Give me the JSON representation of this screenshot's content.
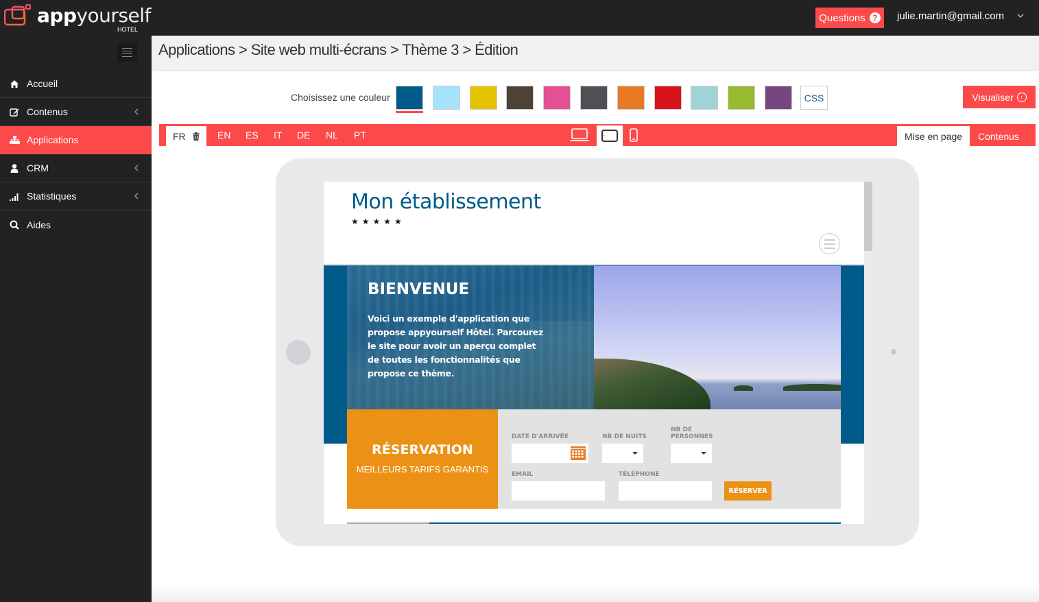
{
  "app": {
    "logo_text_bold": "app",
    "logo_text_light": "yourself",
    "logo_sub": "HOTEL"
  },
  "header": {
    "questions_label": "Questions",
    "questions_icon": "question-circle-icon",
    "user_email": "julie.martin@gmail.com"
  },
  "sidebar": {
    "items": [
      {
        "label": "Accueil",
        "icon": "home-icon",
        "has_submenu": false,
        "active": false
      },
      {
        "label": "Contenus",
        "icon": "edit-icon",
        "has_submenu": true,
        "active": false
      },
      {
        "label": "Applications",
        "icon": "sitemap-icon",
        "has_submenu": false,
        "active": true
      },
      {
        "label": "CRM",
        "icon": "user-icon",
        "has_submenu": true,
        "active": false
      },
      {
        "label": "Statistiques",
        "icon": "signal-icon",
        "has_submenu": true,
        "active": false
      },
      {
        "label": "Aides",
        "icon": "search-icon",
        "has_submenu": false,
        "active": false
      }
    ]
  },
  "breadcrumb": "Applications > Site web multi-écrans > Thème 3 > Édition",
  "colors": {
    "label": "Choisissez une couleur",
    "selected_index": 0,
    "swatches": [
      "#005b8a",
      "#a6e2fa",
      "#e6c300",
      "#4e4135",
      "#e35094",
      "#4f4f55",
      "#e87a26",
      "#d8111a",
      "#9fd4d6",
      "#98ba30",
      "#774681"
    ],
    "css_label": "CSS"
  },
  "visualiser_label": "Visualiser",
  "languages": {
    "items": [
      "FR",
      "EN",
      "ES",
      "IT",
      "DE",
      "NL",
      "PT"
    ],
    "active": "FR"
  },
  "devices": {
    "items": [
      "desktop-icon",
      "tablet-icon",
      "mobile-icon"
    ],
    "active": "tablet-icon"
  },
  "mode_tabs": {
    "items": [
      "Mise en page",
      "Contenus"
    ],
    "active": "Mise en page"
  },
  "preview": {
    "site_title": "Mon établissement",
    "stars": "★★★★★",
    "hero_title": "BIENVENUE",
    "hero_text": "Voici un exemple d'application que propose appyourself Hôtel. Parcourez le site pour avoir un aperçu complet de toutes les fonctionnalités que propose ce thème.",
    "reservation": {
      "title": "RÉSERVATION",
      "subtitle": "MEILLEURS TARIFS GARANTIS",
      "date_label": "DATE D'ARRIVÉE",
      "nights_label": "NB DE NUITS",
      "persons_label": "NB DE PERSONNES",
      "email_label": "EMAIL",
      "phone_label": "TÉLÉPHONE",
      "date_value": "",
      "nights_value": "",
      "persons_value": "",
      "email_value": "",
      "phone_value": "",
      "submit_label": "RÉSERVER"
    }
  },
  "theme": {
    "accent": "#fc4a4a",
    "dark": "#222222",
    "preview_blue": "#005b8a",
    "preview_orange": "#eb9216"
  }
}
